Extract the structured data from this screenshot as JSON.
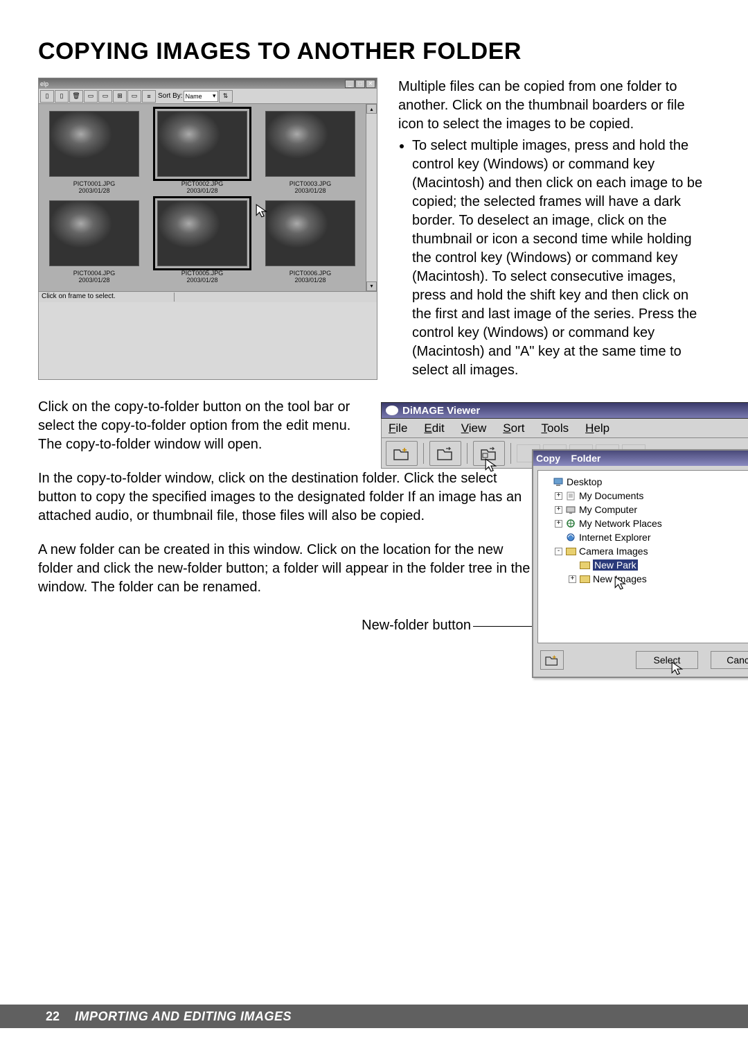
{
  "heading": "COPYING IMAGES TO ANOTHER FOLDER",
  "thumbApp": {
    "titlebar_left": "elp",
    "win_buttons": [
      "_",
      "□",
      "✕"
    ],
    "sort_label": "Sort By:",
    "sort_value": "Name",
    "status_text": "Click on frame to select.",
    "cells": [
      {
        "name": "PICT0001.JPG",
        "date": "2003/01/28",
        "selected": false
      },
      {
        "name": "PICT0002.JPG",
        "date": "2003/01/28",
        "selected": true
      },
      {
        "name": "PICT0003.JPG",
        "date": "2003/01/28",
        "selected": false
      },
      {
        "name": "PICT0004.JPG",
        "date": "2003/01/28",
        "selected": false
      },
      {
        "name": "PICT0005.JPG",
        "date": "2003/01/28",
        "selected": true
      },
      {
        "name": "PICT0006.JPG",
        "date": "2003/01/28",
        "selected": false
      }
    ]
  },
  "intro": {
    "p1": "Multiple files can be copied from one folder to another. Click on the thumbnail boarders or file icon to select the images to be copied.",
    "b1": "To select multiple images, press and hold the control key (Windows) or command key (Macintosh) and then click on each image to be copied; the selected frames will have a dark border. To deselect an image, click on the thumbnail or icon a second time while holding the control key (Windows) or command key (Macintosh). To select consecutive images, press and hold the shift key and then click on the first and last image of the series. Press the control key (Windows) or command key (Macintosh) and \"A\" key at the same time to select all images."
  },
  "mid": {
    "p1": "Click on the copy-to-folder button on the tool bar or select the copy-to-folder option from the edit menu. The copy-to-folder window will open."
  },
  "lower": {
    "p1": "In the copy-to-folder window, click on the destination folder. Click the select button to copy the specified images to the designated folder If an image has an attached audio, or thumbnail file, those files will also be copied.",
    "p2": "A new folder can be created in this window. Click on the location for the new folder and click the new-folder button; a folder will appear in the folder tree in the window. The folder can be renamed.",
    "newfolder_label": "New-folder button"
  },
  "viewer": {
    "title": "DiMAGE Viewer",
    "menu": [
      "File",
      "Edit",
      "View",
      "Sort",
      "Tools",
      "Help"
    ]
  },
  "copyDialog": {
    "title": "Copy to Folder",
    "tree": [
      {
        "level": 0,
        "expand": "",
        "icon": "desktop",
        "label": "Desktop",
        "selected": false
      },
      {
        "level": 1,
        "expand": "+",
        "icon": "docs",
        "label": "My Documents",
        "selected": false
      },
      {
        "level": 1,
        "expand": "+",
        "icon": "computer",
        "label": "My Computer",
        "selected": false
      },
      {
        "level": 1,
        "expand": "+",
        "icon": "network",
        "label": "My Network Places",
        "selected": false
      },
      {
        "level": 1,
        "expand": "",
        "icon": "ie",
        "label": "Internet Explorer",
        "selected": false
      },
      {
        "level": 1,
        "expand": "-",
        "icon": "folder",
        "label": "Camera Images",
        "selected": false
      },
      {
        "level": 2,
        "expand": "",
        "icon": "folder",
        "label": "New Park",
        "selected": true
      },
      {
        "level": 2,
        "expand": "+",
        "icon": "folder",
        "label": "New Images",
        "selected": false
      }
    ],
    "select_btn": "Select",
    "cancel_btn": "Cancel"
  },
  "footer": {
    "page": "22",
    "chapter": "IMPORTING AND EDITING IMAGES"
  }
}
